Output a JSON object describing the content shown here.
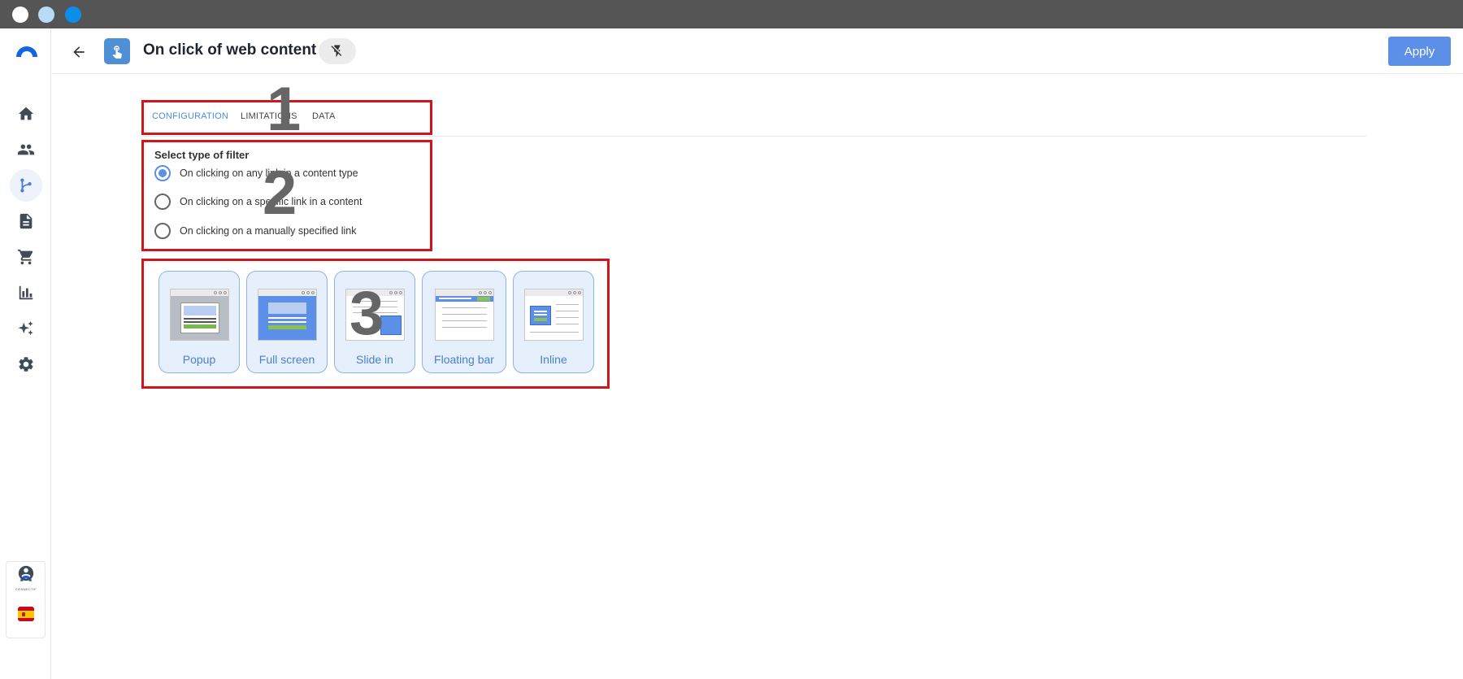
{
  "header": {
    "title": "On click of web content",
    "apply_label": "Apply"
  },
  "tabs": [
    {
      "label": "CONFIGURATION",
      "active": true
    },
    {
      "label": "LIMITATIONS",
      "active": false
    },
    {
      "label": "DATA",
      "active": false
    }
  ],
  "filter": {
    "heading": "Select type of filter",
    "options": [
      {
        "label": "On clicking on any link in a content type",
        "selected": true
      },
      {
        "label": "On clicking on a specific link in a content",
        "selected": false
      },
      {
        "label": "On clicking on a manually specified link",
        "selected": false
      }
    ]
  },
  "formats": [
    {
      "label": "Popup"
    },
    {
      "label": "Full screen"
    },
    {
      "label": "Slide in"
    },
    {
      "label": "Floating bar"
    },
    {
      "label": "Inline"
    }
  ],
  "annotations": [
    "1",
    "2",
    "3"
  ],
  "sidebar": {
    "items": [
      "home-icon",
      "people-icon",
      "flow-icon",
      "document-icon",
      "cart-icon",
      "chart-icon",
      "sparkle-icon",
      "gear-icon"
    ],
    "brand_text": "CONNECTIF",
    "language_flag": "spain-flag"
  },
  "colors": {
    "accent": "#5b8fe8",
    "annotation_red": "#d0161a",
    "card_bg": "#e6f0fc"
  }
}
